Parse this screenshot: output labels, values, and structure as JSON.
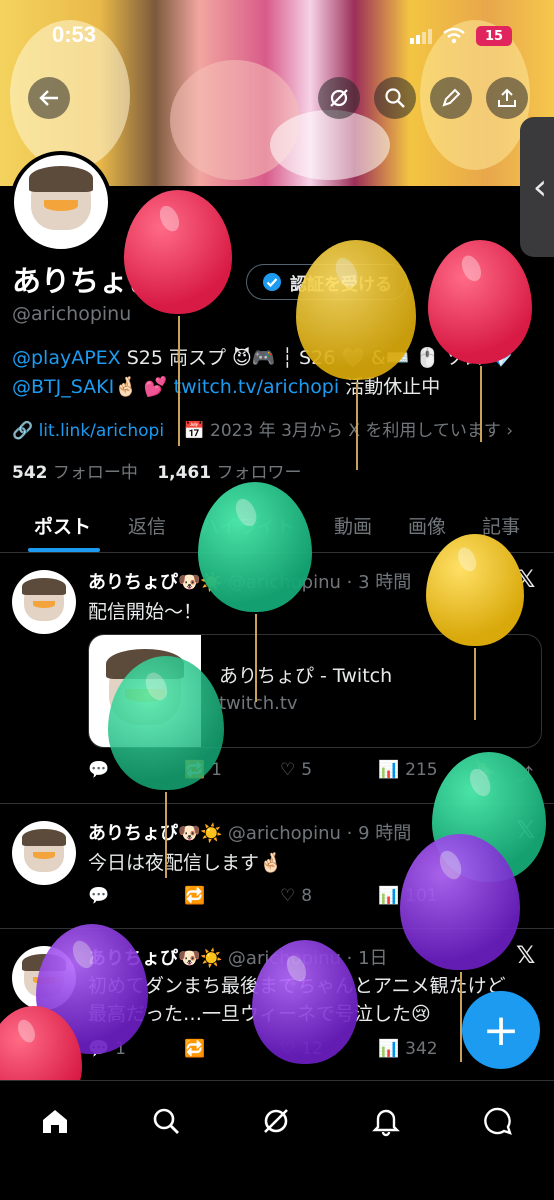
{
  "status": {
    "time": "0:53",
    "battery": "15"
  },
  "profile": {
    "name": "ありちょぴ",
    "name_emoji": "🐶☀️",
    "verify_button": "認証を受ける",
    "handle": "@arichopinu",
    "bio_line1_link": "@playAPEX",
    "bio_line1_text": " S25 両スプ 😈🎮 ┆ S26 🖤 &⌨️ 🖱️ ソロ 💎",
    "bio_line2_link1": "@BTJ_SAKI",
    "bio_line2_mid": "🤞🏻 💕 ",
    "bio_line2_link2": "twitch.tv/arichopi",
    "bio_line2_end": " 活動休止中",
    "website": "lit.link/arichopi",
    "joined": "2023 年 3月から X を利用しています",
    "following_count": "542",
    "following_label": " フォロー中",
    "followers_count": "1,461",
    "followers_label": " フォロワー"
  },
  "tabs": [
    "ポスト",
    "返信",
    "ハイライト",
    "動画",
    "画像",
    "記事"
  ],
  "posts": [
    {
      "name": "ありちょぴ🐶☀️",
      "meta": "@arichopinu · 3 時間",
      "text": "配信開始〜！",
      "card_title": "ありちょぴ - Twitch",
      "card_domain": "twitch.tv",
      "replies": "",
      "reposts": "1",
      "likes": "5",
      "views": "215"
    },
    {
      "name": "ありちょぴ🐶☀️",
      "meta": "@arichopinu · 9 時間",
      "text": "今日は夜配信します🤞🏻",
      "replies": "",
      "reposts": "",
      "likes": "8",
      "views": "101"
    },
    {
      "name": "ありちょぴ🐶☀️",
      "meta": "@arichopinu · 1日",
      "text_line1": "初めてダンまち最後までちゃんとアニメ観たけど",
      "text_line2": "最高だった…一旦ウィーネで号泣した😢",
      "replies": "1",
      "reposts": "",
      "likes": "12",
      "views": "342"
    }
  ],
  "colors": {
    "accent": "#1d9bf0",
    "background": "#000000",
    "muted": "#71767b"
  },
  "icons": [
    "back-arrow-icon",
    "grok-icon",
    "search-icon",
    "edit-icon",
    "share-icon",
    "home-icon",
    "explore-icon",
    "notifications-icon",
    "messages-icon",
    "compose-icon",
    "x-logo-icon"
  ]
}
